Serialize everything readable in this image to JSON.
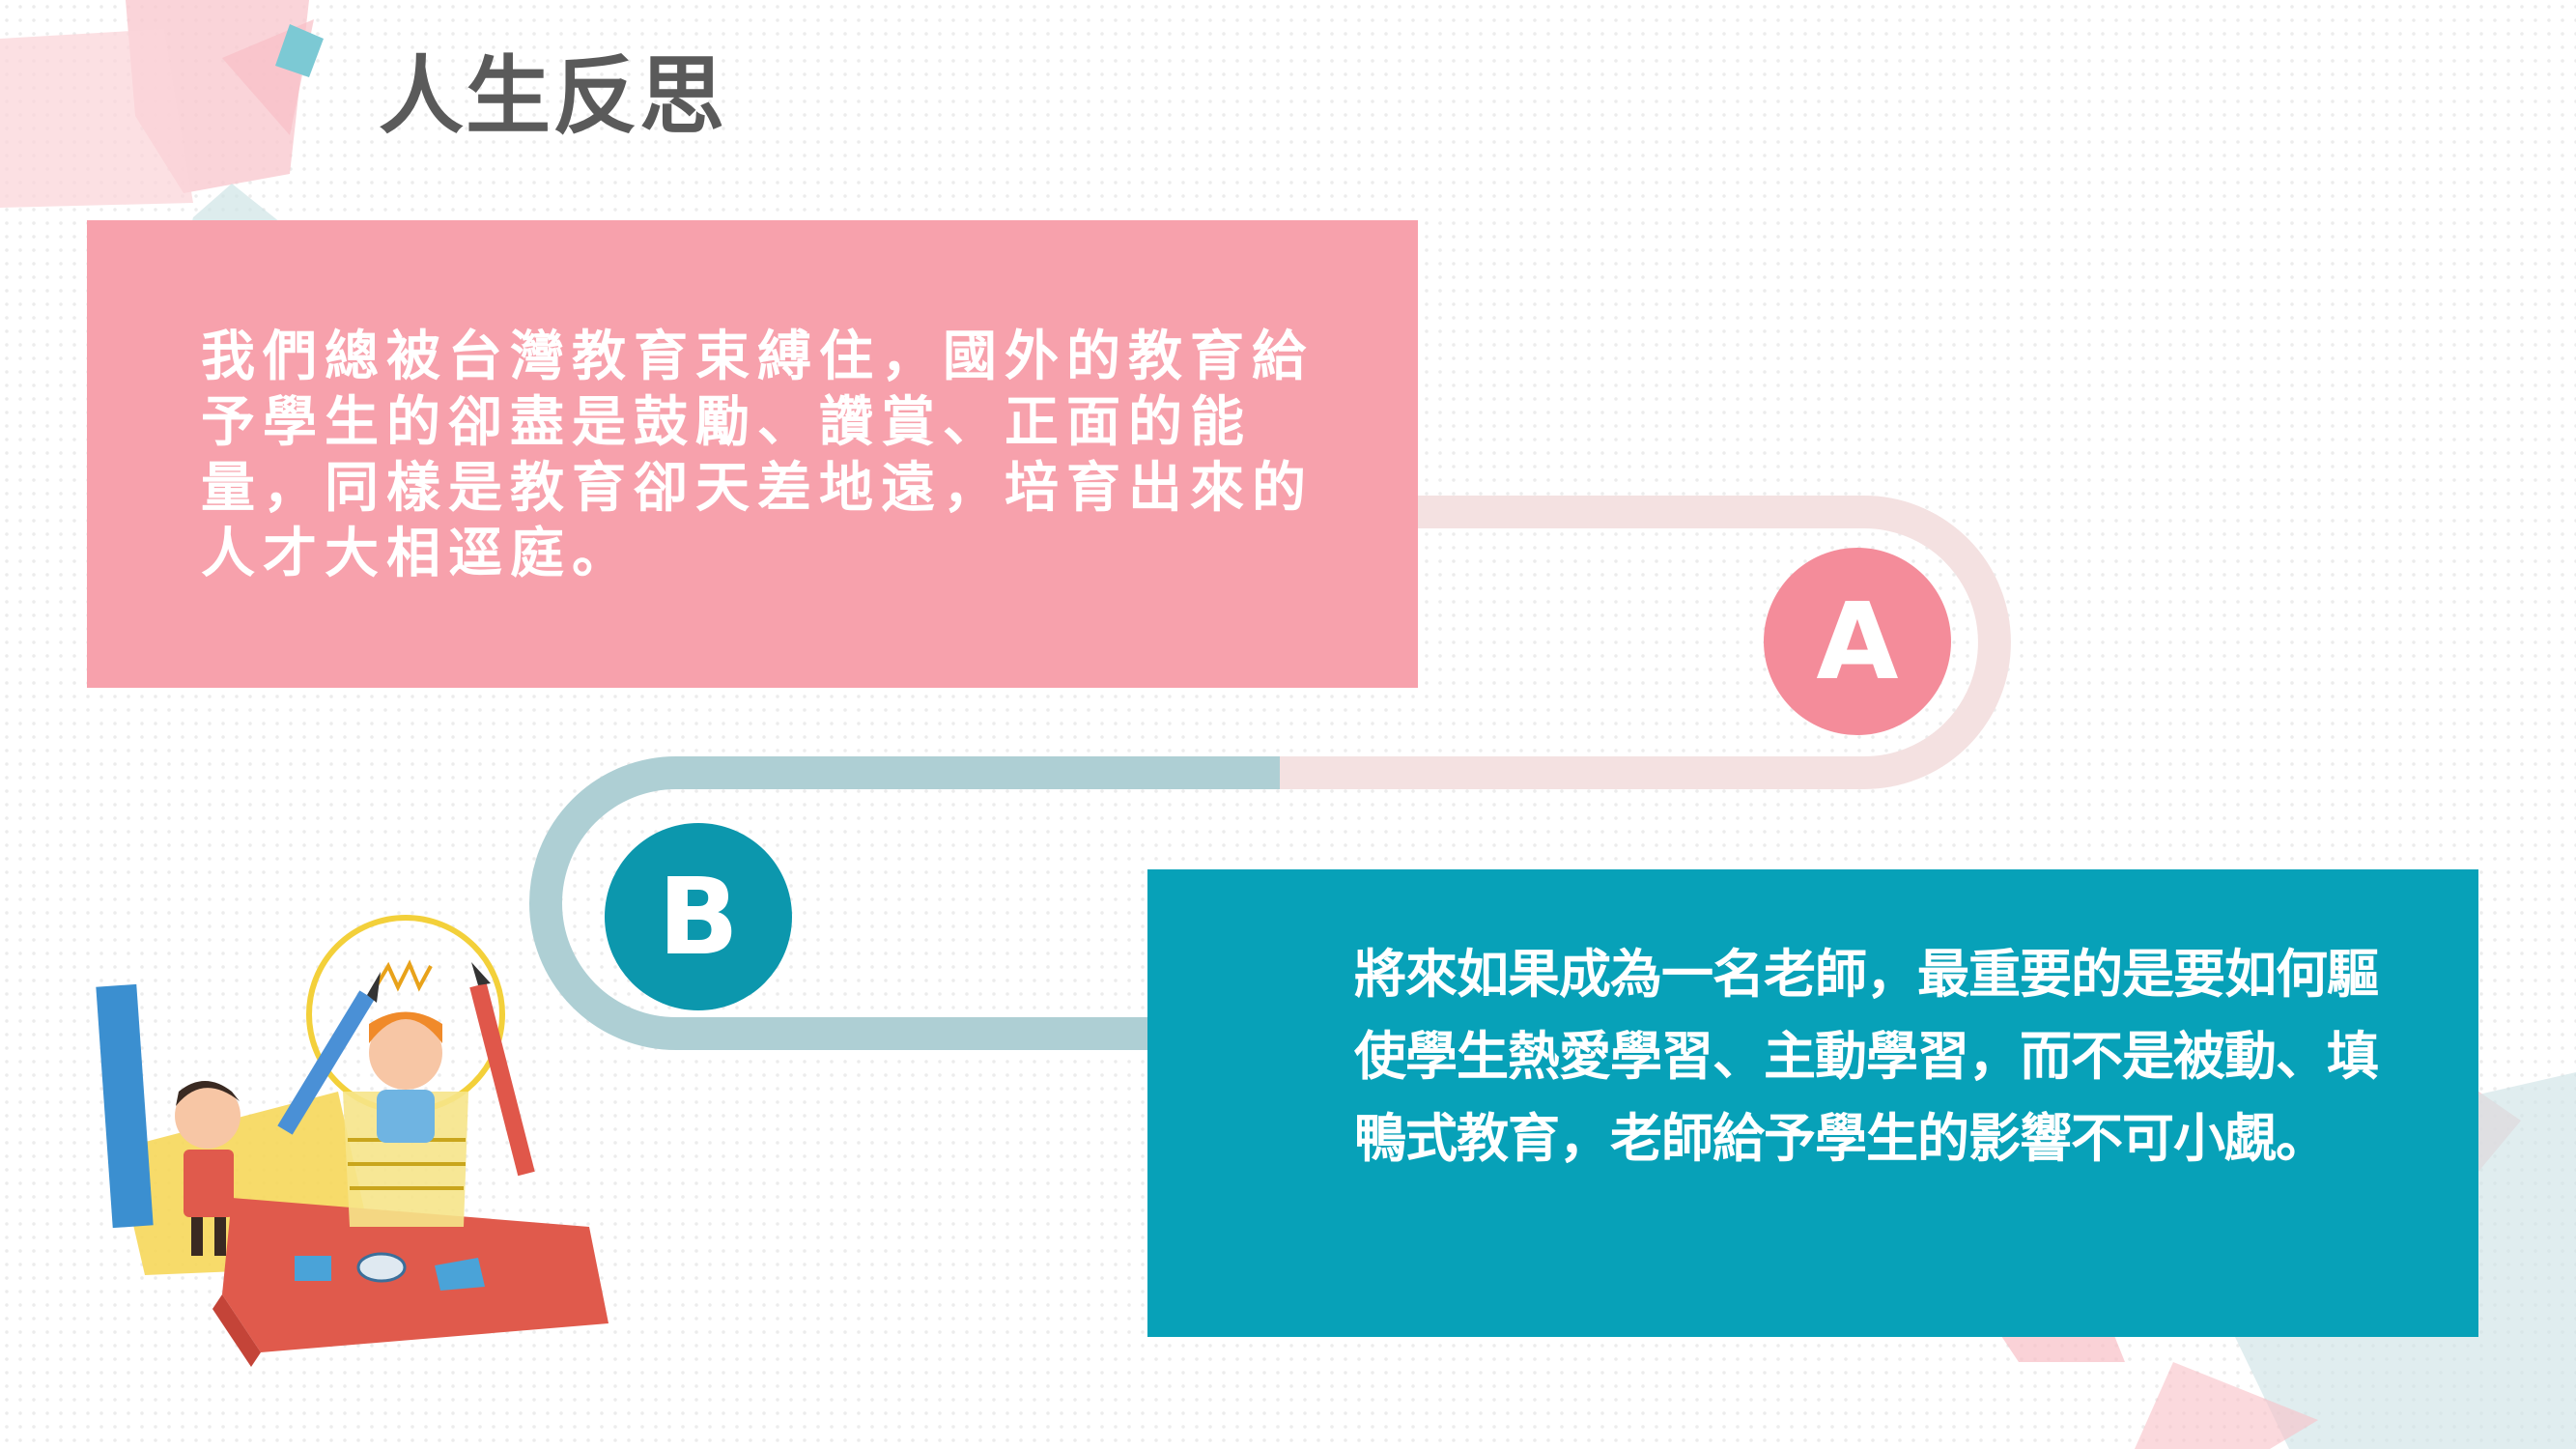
{
  "title": "人生反思",
  "point_a": {
    "badge": "A",
    "text": "我們總被台灣教育束縛住，國外的教育給予學生的卻盡是鼓勵、讚賞、正面的能量，同樣是教育卻天差地遠，培育出來的人才大相逕庭。"
  },
  "point_b": {
    "badge": "B",
    "text": "將來如果成為一名老師，最重要的是要如何驅使學生熱愛學習、主動學習，而不是被動、填鴨式教育，老師給予學生的影響不可小覷。"
  },
  "colors": {
    "pink": "#f7a1ac",
    "pink_badge": "#f48c9a",
    "teal": "#07a1b8",
    "teal_badge": "#0c97ad",
    "light_pink_path": "#f4e1e1",
    "light_teal_path": "#aecfd4",
    "title_gray": "#5a5a5a"
  }
}
